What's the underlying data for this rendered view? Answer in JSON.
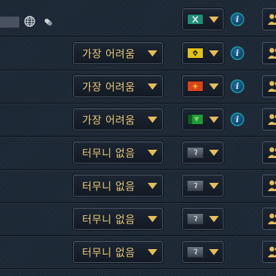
{
  "colors": {
    "background": "#1f2a38",
    "gold": "#e5bd5c",
    "info_teal": "#1a8e9a"
  },
  "header_row": {
    "icons": [
      "globe-icon",
      "capsule-icon"
    ],
    "team_flag": "team-flag-teal",
    "info_icon": "info-icon",
    "players_icon": "players-icon"
  },
  "rows": [
    {
      "difficulty": "가장 어려움",
      "team_flag": "team-flag-yellow",
      "info_icon": true
    },
    {
      "difficulty": "가장 어려움",
      "team_flag": "team-flag-orange",
      "info_icon": true
    },
    {
      "difficulty": "가장 어려움",
      "team_flag": "team-flag-green",
      "info_icon": true
    },
    {
      "difficulty": "터무니 없음",
      "team_flag": "team-flag-empty",
      "info_icon": false
    },
    {
      "difficulty": "터무니 없음",
      "team_flag": "team-flag-empty",
      "info_icon": false
    },
    {
      "difficulty": "터무니 없음",
      "team_flag": "team-flag-empty",
      "info_icon": false
    },
    {
      "difficulty": "터무니 없음",
      "team_flag": "team-flag-empty",
      "info_icon": false
    }
  ]
}
